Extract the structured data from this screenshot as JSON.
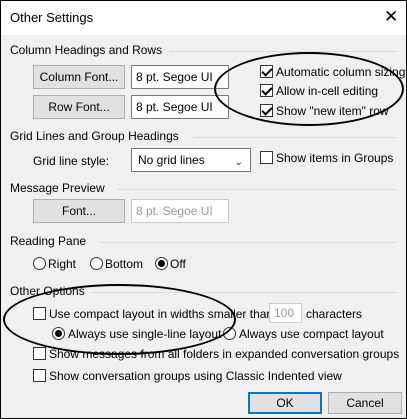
{
  "window": {
    "title": "Other Settings",
    "close_glyph": "✕"
  },
  "column_headings": {
    "group_label": "Column Headings and Rows",
    "column_font_button": "Column Font...",
    "column_font_value": "8 pt. Segoe UI",
    "row_font_button": "Row Font...",
    "row_font_value": "8 pt. Segoe UI",
    "options": [
      {
        "label": "Automatic column sizing",
        "checked": true
      },
      {
        "label": "Allow in-cell editing",
        "checked": true
      },
      {
        "label": "Show \"new item\" row",
        "checked": true
      }
    ]
  },
  "grid_lines": {
    "group_label": "Grid Lines and Group Headings",
    "style_label": "Grid line style:",
    "style_value": "No grid lines",
    "show_in_groups_label": "Show items in Groups",
    "show_in_groups_checked": false
  },
  "message_preview": {
    "group_label": "Message Preview",
    "font_button": "Font...",
    "font_value": "8 pt. Segoe UI"
  },
  "reading_pane": {
    "group_label": "Reading Pane",
    "options": [
      {
        "label": "Right",
        "selected": false
      },
      {
        "label": "Bottom",
        "selected": false
      },
      {
        "label": "Off",
        "selected": true
      }
    ]
  },
  "other_options": {
    "group_label": "Other Options",
    "compact_layout_label": "Use compact layout in widths smaller than",
    "compact_layout_checked": false,
    "compact_width_value": "100",
    "characters_label": "characters",
    "single_line_label": "Always use single-line layout",
    "single_line_selected": true,
    "compact_always_label": "Always use compact layout",
    "compact_always_selected": false,
    "show_all_folders_label": "Show messages from all folders in expanded conversation groups",
    "show_all_folders_checked": false,
    "classic_indented_label": "Show conversation groups using Classic Indented view",
    "classic_indented_checked": false
  },
  "footer": {
    "ok_label": "OK",
    "cancel_label": "Cancel"
  }
}
